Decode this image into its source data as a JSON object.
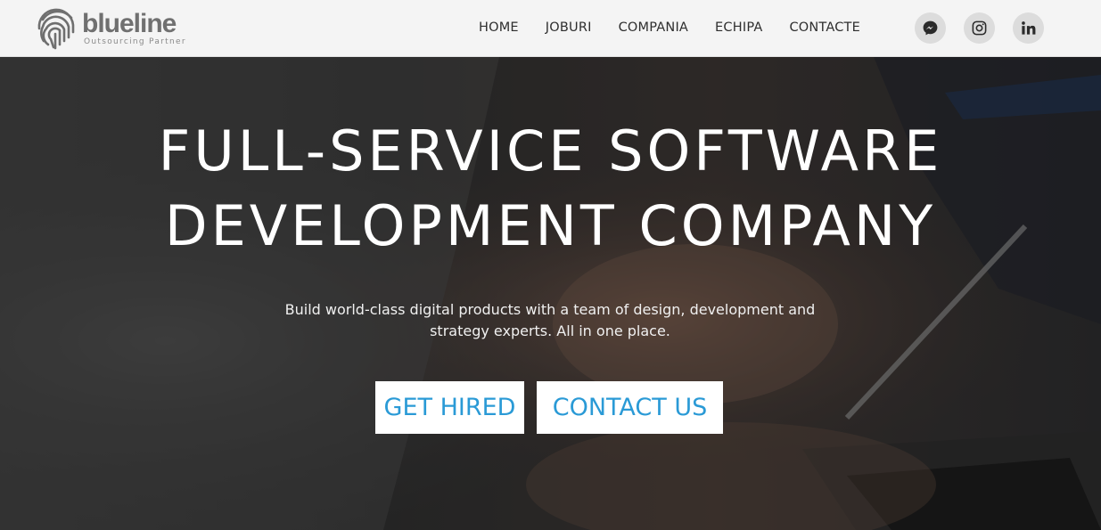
{
  "brand": {
    "name": "blueline",
    "tagline": "Outsourcing Partner"
  },
  "nav": {
    "items": [
      {
        "label": "HOME",
        "name": "nav-home"
      },
      {
        "label": "JOBURI",
        "name": "nav-joburi"
      },
      {
        "label": "COMPANIA",
        "name": "nav-compania"
      },
      {
        "label": "ECHIPA",
        "name": "nav-echipa"
      },
      {
        "label": "CONTACTE",
        "name": "nav-contacte"
      }
    ]
  },
  "social": [
    "messenger-icon",
    "instagram-icon",
    "linkedin-icon"
  ],
  "hero": {
    "title_line1": "FULL-SERVICE SOFTWARE",
    "title_line2": "DEVELOPMENT COMPANY",
    "subtitle_line1": "Build world-class digital products with a team of design, development and",
    "subtitle_line2": "strategy experts. All in one place.",
    "primary_button": "GET HIRED",
    "secondary_button": "CONTACT US"
  },
  "colors": {
    "accent": "#2a9ad6",
    "header_bg": "#f4f4f4",
    "logo_gray": "#707070"
  }
}
